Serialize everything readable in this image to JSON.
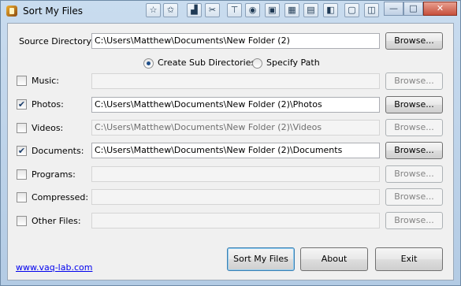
{
  "window": {
    "title": "Sort My Files",
    "minimize_glyph": "—",
    "maximize_glyph": "□",
    "close_glyph": "✕"
  },
  "toolbar_icons": [
    "pin-icon",
    "chart-icon",
    "scissors-icon",
    "filter-icon",
    "palette-icon",
    "frame-icon",
    "grid-icon",
    "stack-icon",
    "layers-icon",
    "window-icon",
    "restore-icon"
  ],
  "source": {
    "label": "Source Directory:",
    "value": "C:\\Users\\Matthew\\Documents\\New Folder (2)",
    "browse_label": "Browse..."
  },
  "mode": {
    "create_sub": "Create Sub Directories",
    "specify_path": "Specify Path",
    "selected": "create_sub"
  },
  "categories": [
    {
      "key": "music",
      "label": "Music:",
      "checked": false,
      "value": "",
      "browse": "Browse..."
    },
    {
      "key": "photos",
      "label": "Photos:",
      "checked": true,
      "value": "C:\\Users\\Matthew\\Documents\\New Folder (2)\\Photos",
      "browse": "Browse..."
    },
    {
      "key": "videos",
      "label": "Videos:",
      "checked": false,
      "value": "C:\\Users\\Matthew\\Documents\\New Folder (2)\\Videos",
      "browse": "Browse..."
    },
    {
      "key": "documents",
      "label": "Documents:",
      "checked": true,
      "value": "C:\\Users\\Matthew\\Documents\\New Folder (2)\\Documents",
      "browse": "Browse..."
    },
    {
      "key": "programs",
      "label": "Programs:",
      "checked": false,
      "value": "",
      "browse": "Browse..."
    },
    {
      "key": "compressed",
      "label": "Compressed:",
      "checked": false,
      "value": "",
      "browse": "Browse..."
    },
    {
      "key": "other",
      "label": "Other Files:",
      "checked": false,
      "value": "",
      "browse": "Browse..."
    }
  ],
  "footer": {
    "link": "www.vaq-lab.com",
    "sort_label": "Sort My Files",
    "about_label": "About",
    "exit_label": "Exit"
  }
}
